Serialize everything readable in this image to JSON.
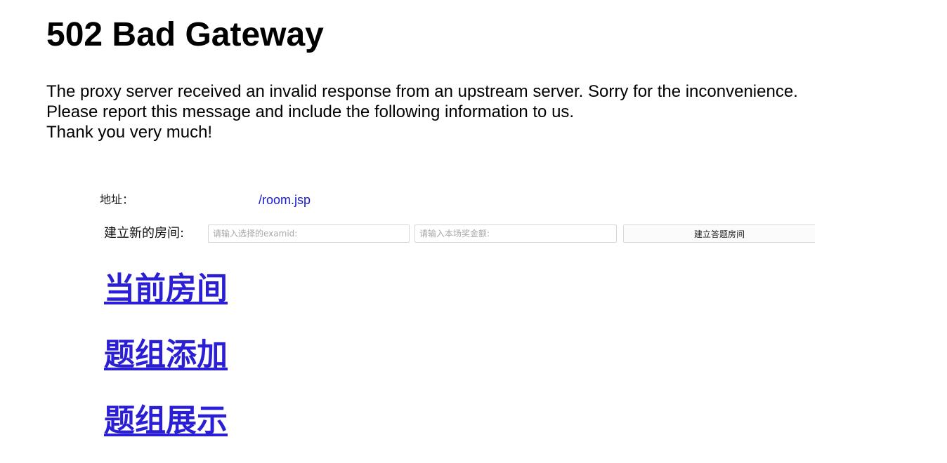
{
  "error": {
    "title": "502 Bad Gateway",
    "lines": [
      "The proxy server received an invalid response from an upstream server. Sorry for the inconvenience.",
      "Please report this message and include the following information to us.",
      "Thank you very much!"
    ]
  },
  "address": {
    "label": "地址：",
    "value": "/room.jsp"
  },
  "create_room": {
    "label": "建立新的房间:",
    "examid_placeholder": "请输入选择的examid:",
    "amount_placeholder": "请输入本场奖金额:",
    "button_label": "建立答题房间"
  },
  "nav": {
    "current_rooms": "当前房间",
    "add_question_set": "题组添加",
    "show_question_set": "题组展示"
  },
  "colors": {
    "link": "#2b1fd6",
    "address_link": "#1a1acc"
  }
}
